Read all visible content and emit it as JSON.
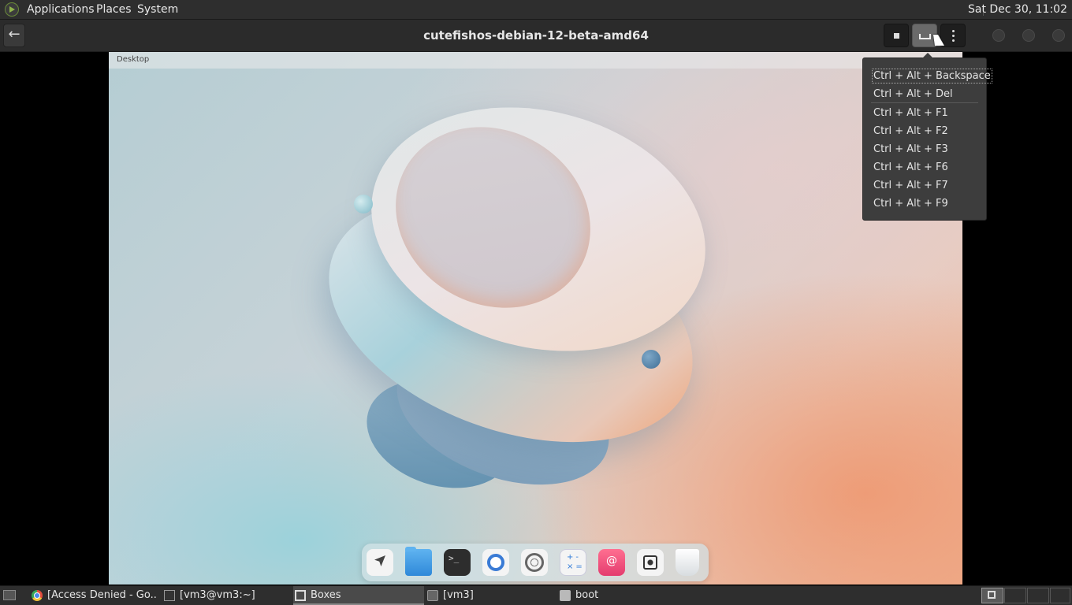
{
  "top_panel": {
    "menus": [
      "Applications",
      "Places",
      "System"
    ],
    "clock": "Sat Dec 30, 11:02",
    "logo_icon": "distro-logo-icon"
  },
  "header": {
    "title": "cutefishos-debian-12-beta-amd64",
    "back_icon": "back-arrow-icon",
    "stop_icon": "stop-icon",
    "keys_icon": "keyboard-icon",
    "menu_icon": "kebab-menu-icon"
  },
  "vm": {
    "topbar_label": "Desktop",
    "dock_apps": [
      "launcher",
      "files",
      "terminal",
      "browser",
      "settings",
      "calculator",
      "debian",
      "screenshot",
      "trash"
    ],
    "terminal_glyph": ">_"
  },
  "keys_menu": {
    "items": [
      "Ctrl + Alt + Backspace",
      "Ctrl + Alt + Del",
      "Ctrl + Alt + F1",
      "Ctrl + Alt + F2",
      "Ctrl + Alt + F3",
      "Ctrl + Alt + F6",
      "Ctrl + Alt + F7",
      "Ctrl + Alt + F9"
    ]
  },
  "taskbar": {
    "tasks": [
      {
        "label": "[Access Denied - Go..."
      },
      {
        "label": "[vm3@vm3:~]"
      },
      {
        "label": "Boxes"
      },
      {
        "label": "[vm3]"
      },
      {
        "label": "boot"
      }
    ]
  },
  "colors": {
    "panel_bg": "#2e2e2e",
    "header_bg": "#2b2b2b",
    "popover_bg": "#3d3d3d",
    "wallpaper_warm": "#efb495",
    "wallpaper_cool": "#b5cdd3"
  }
}
